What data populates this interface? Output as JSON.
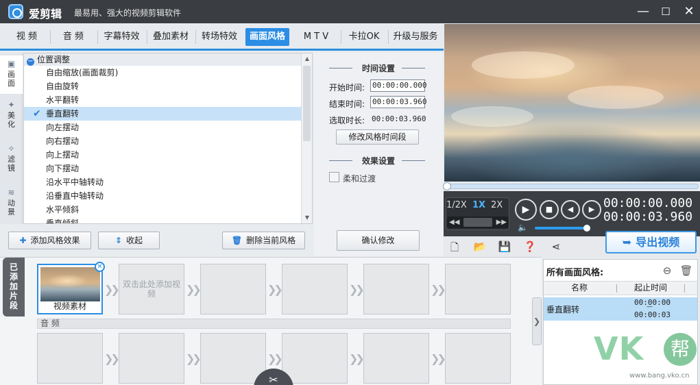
{
  "app": {
    "name": "爱剪辑",
    "slogan": "最易用、强大的视频剪辑软件",
    "minimize": "—",
    "maximize": "☐",
    "close": "✕"
  },
  "tabs": [
    {
      "label": "视  频"
    },
    {
      "label": "音  频"
    },
    {
      "label": "字幕特效"
    },
    {
      "label": "叠加素材"
    },
    {
      "label": "转场特效"
    },
    {
      "label": "画面风格",
      "active": true
    },
    {
      "label": "M T V"
    },
    {
      "label": "卡拉OK"
    },
    {
      "label": "升级与服务"
    }
  ],
  "categories": [
    {
      "label": "画面",
      "icon": "screen-icon",
      "active": true
    },
    {
      "label": "美化",
      "icon": "magic-wand-icon"
    },
    {
      "label": "滤镜",
      "icon": "filter-wand-icon"
    },
    {
      "label": "动景",
      "icon": "waves-icon"
    }
  ],
  "effect_list": {
    "group": "位置调整",
    "items": [
      "自由缩放(画面裁剪)",
      "自由旋转",
      "水平翻转",
      "垂直翻转",
      "向左摆动",
      "向右摆动",
      "向上摆动",
      "向下摆动",
      "沿水平中轴转动",
      "沿垂直中轴转动",
      "水平倾斜",
      "垂直倾斜"
    ],
    "selected_index": 3
  },
  "list_buttons": {
    "add": "添加风格效果",
    "collapse": "收起",
    "delete": "删除当前风格"
  },
  "time_settings": {
    "title": "时间设置",
    "start_label": "开始时间:",
    "start_value": "00:00:00.000",
    "end_label": "结束时间:",
    "end_value": "00:00:03.960",
    "duration_label": "选取时长:",
    "duration_value": "00:00:03.960",
    "modify_button": "修改风格时间段"
  },
  "effect_settings": {
    "title": "效果设置",
    "soft_filter_label": "柔和过渡",
    "soft_filter_checked": false
  },
  "confirm_button": "确认修改",
  "player": {
    "speeds": [
      "1/2X",
      "1X",
      "2X"
    ],
    "active_speed": "1X",
    "current_time": "00:00:00.000",
    "total_time": "00:00:03.960",
    "progress": 0,
    "volume": 0.93
  },
  "export_button": "导出视频",
  "timeline": {
    "added_tab": "已添加片段",
    "clip_label": "视频素材",
    "empty_hint": "双击此处添加视频",
    "audio_label": "音 频"
  },
  "right_panel": {
    "title": "所有画面风格:",
    "col_name": "名称",
    "col_time": "起止时间",
    "rows": [
      {
        "name": "垂直翻转",
        "start": "00:00:00",
        "sep": "—",
        "end": "00:00:03"
      }
    ]
  },
  "watermark": {
    "text": "VK",
    "badge": "帮",
    "url": "www.bang.vko.cn"
  },
  "colors": {
    "accent": "#2b8de4",
    "titlebar": "#3a3d41",
    "selection": "#c7e2f8"
  }
}
